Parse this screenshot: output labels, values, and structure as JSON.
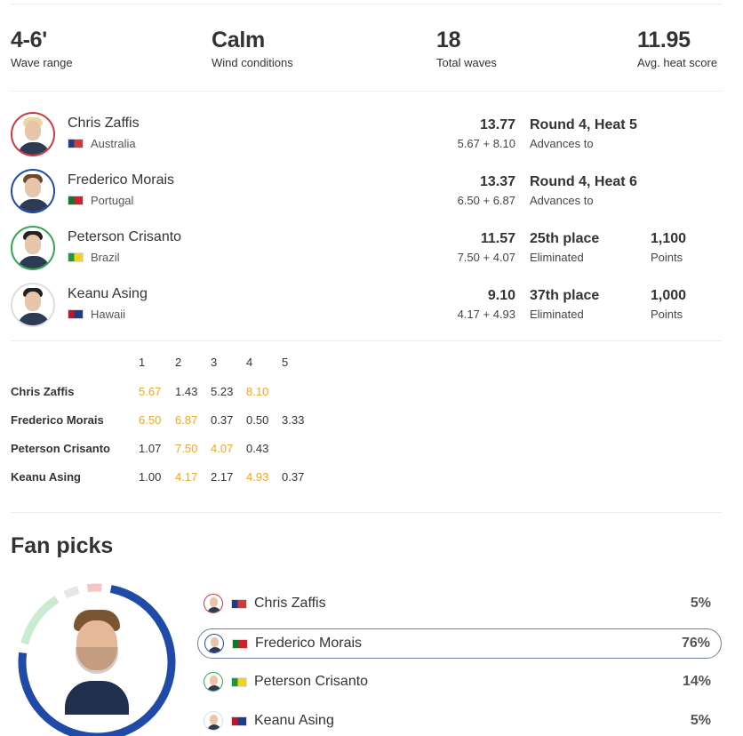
{
  "stats": [
    {
      "value": "4-6'",
      "label": "Wave range"
    },
    {
      "value": "Calm",
      "label": "Wind conditions"
    },
    {
      "value": "18",
      "label": "Total waves"
    },
    {
      "value": "11.95",
      "label": "Avg. heat score"
    }
  ],
  "surfers": [
    {
      "name": "Chris Zaffis",
      "country": "Australia",
      "total": "13.77",
      "breakdown": "5.67 + 8.10",
      "result": "Round 4, Heat 5",
      "result_label": "Advances to",
      "points": "",
      "points_label": "",
      "ring_color": "#d0393e",
      "hair_color": "#e8d9a0",
      "flag_colors": [
        "#1f3c88",
        "#d0393e"
      ]
    },
    {
      "name": "Frederico Morais",
      "country": "Portugal",
      "total": "13.37",
      "breakdown": "6.50 + 6.87",
      "result": "Round 4, Heat 6",
      "result_label": "Advances to",
      "points": "",
      "points_label": "",
      "ring_color": "#1f4aa8",
      "hair_color": "#6b4a2b",
      "flag_colors": [
        "#0b7a2a",
        "#d0202e"
      ]
    },
    {
      "name": "Peterson Crisanto",
      "country": "Brazil",
      "total": "11.57",
      "breakdown": "7.50 + 4.07",
      "result": "25th place",
      "result_label": "Eliminated",
      "points": "1,100",
      "points_label": "Points",
      "ring_color": "#2fa84f",
      "hair_color": "#222222",
      "flag_colors": [
        "#1e9a3c",
        "#f2d21b"
      ]
    },
    {
      "name": "Keanu Asing",
      "country": "Hawaii",
      "total": "9.10",
      "breakdown": "4.17 + 4.93",
      "result": "37th place",
      "result_label": "Eliminated",
      "points": "1,000",
      "points_label": "Points",
      "ring_color": "#dddddd",
      "hair_color": "#222222",
      "flag_colors": [
        "#c8102e",
        "#1f3c88"
      ]
    }
  ],
  "wave_table": {
    "headers": [
      "1",
      "2",
      "3",
      "4",
      "5"
    ],
    "rows": [
      {
        "name": "Chris Zaffis",
        "scores": [
          "5.67",
          "1.43",
          "5.23",
          "8.10",
          ""
        ],
        "best": [
          0,
          3
        ]
      },
      {
        "name": "Frederico Morais",
        "scores": [
          "6.50",
          "6.87",
          "0.37",
          "0.50",
          "3.33"
        ],
        "best": [
          0,
          1
        ]
      },
      {
        "name": "Peterson Crisanto",
        "scores": [
          "1.07",
          "7.50",
          "4.07",
          "0.43",
          ""
        ],
        "best": [
          1,
          2
        ]
      },
      {
        "name": "Keanu Asing",
        "scores": [
          "1.00",
          "4.17",
          "2.17",
          "4.93",
          "0.37"
        ],
        "best": [
          1,
          3
        ]
      }
    ]
  },
  "fan_picks": {
    "title": "Fan picks",
    "picks": [
      {
        "name": "Chris Zaffis",
        "pct": "5%",
        "fraction": 0.05,
        "color": "#d0393e",
        "selected": false
      },
      {
        "name": "Frederico Morais",
        "pct": "76%",
        "fraction": 0.76,
        "color": "#1f4aa8",
        "selected": true
      },
      {
        "name": "Peterson Crisanto",
        "pct": "14%",
        "fraction": 0.14,
        "color": "#2fa84f",
        "selected": false
      },
      {
        "name": "Keanu Asing",
        "pct": "5%",
        "fraction": 0.05,
        "color": "#dddddd",
        "selected": false
      }
    ]
  },
  "colors": {
    "accent_best": "#f5a623",
    "divider": "#ececec"
  }
}
